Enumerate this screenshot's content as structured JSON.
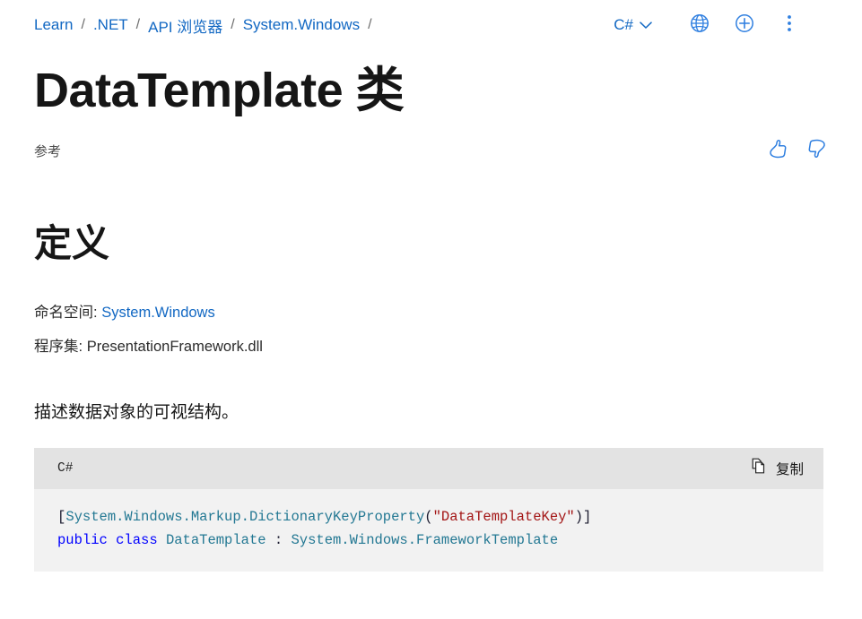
{
  "breadcrumb": {
    "items": [
      {
        "label": "Learn"
      },
      {
        "label": ".NET"
      },
      {
        "label": "API 浏览器"
      },
      {
        "label": "System.Windows"
      }
    ],
    "separator": "/"
  },
  "topbar": {
    "language_label": "C#",
    "chevron_icon": "chevron-down-icon",
    "globe_icon": "globe-icon",
    "plus_icon": "plus-circle-icon",
    "more_icon": "more-vertical-icon"
  },
  "page": {
    "title": "DataTemplate 类",
    "subtitle": "参考"
  },
  "feedback": {
    "thumbs_up_icon": "thumbs-up-icon",
    "thumbs_down_icon": "thumbs-down-icon"
  },
  "definition": {
    "heading": "定义",
    "namespace_label": "命名空间:",
    "namespace_value": "System.Windows",
    "assembly_label": "程序集:",
    "assembly_value": "PresentationFramework.dll",
    "description": "描述数据对象的可视结构。"
  },
  "code": {
    "language": "C#",
    "copy_label": "复制",
    "copy_icon": "copy-icon",
    "line1": {
      "open_bracket": "[",
      "attribute": "System.Windows.Markup.DictionaryKeyProperty",
      "paren_open": "(",
      "string": "\"DataTemplateKey\"",
      "paren_close": ")",
      "close_bracket": "]"
    },
    "line2": {
      "keywords": "public class",
      "class_name": "DataTemplate",
      "colon": ":",
      "base_type": "System.Windows.FrameworkTemplate"
    }
  },
  "colors": {
    "link": "#1268c3",
    "keyword": "#0000ff",
    "type": "#237893",
    "string": "#a31515",
    "code_bg": "#f2f2f2",
    "code_header_bg": "#e3e3e3"
  }
}
